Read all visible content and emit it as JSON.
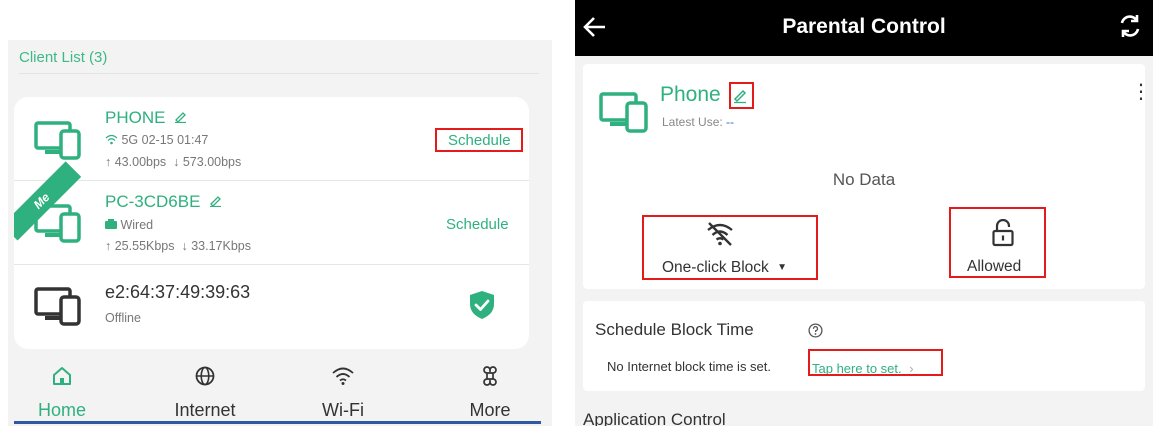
{
  "left": {
    "client_list_title": "Client List (3)",
    "devices": [
      {
        "name": "PHONE",
        "connection": "5G 02-15 01:47",
        "upload": "43.00bps",
        "download": "573.00bps",
        "action": "Schedule",
        "highlighted_action": true
      },
      {
        "name": "PC-3CD6BE",
        "badge": "Me",
        "connection": "Wired",
        "upload": "25.55Kbps",
        "download": "33.17Kbps",
        "action": "Schedule"
      },
      {
        "name": "e2:64:37:49:39:63",
        "status": "Offline",
        "action_icon": "shield-check-icon"
      }
    ],
    "tabs": [
      {
        "label": "Home",
        "icon": "home-icon",
        "active": true
      },
      {
        "label": "Internet",
        "icon": "globe-icon"
      },
      {
        "label": "Wi-Fi",
        "icon": "wifi-icon"
      },
      {
        "label": "More",
        "icon": "more-icon"
      }
    ]
  },
  "right": {
    "header": {
      "title": "Parental Control",
      "back_icon": "back-arrow-icon",
      "refresh_icon": "refresh-icon"
    },
    "device": {
      "name": "Phone",
      "latest_use_label": "Latest Use:",
      "latest_use_value": "--"
    },
    "no_data": "No Data",
    "one_click_block": "One-click Block",
    "allowed": "Allowed",
    "schedule": {
      "title": "Schedule Block Time",
      "message": "No Internet block time is set.",
      "link": "Tap here to set."
    },
    "application_control": "Application Control"
  },
  "colors": {
    "accent": "#2fb07f",
    "highlight": "#e41b1b",
    "header_bg": "#000000",
    "link_blue": "#2d6ad6"
  }
}
